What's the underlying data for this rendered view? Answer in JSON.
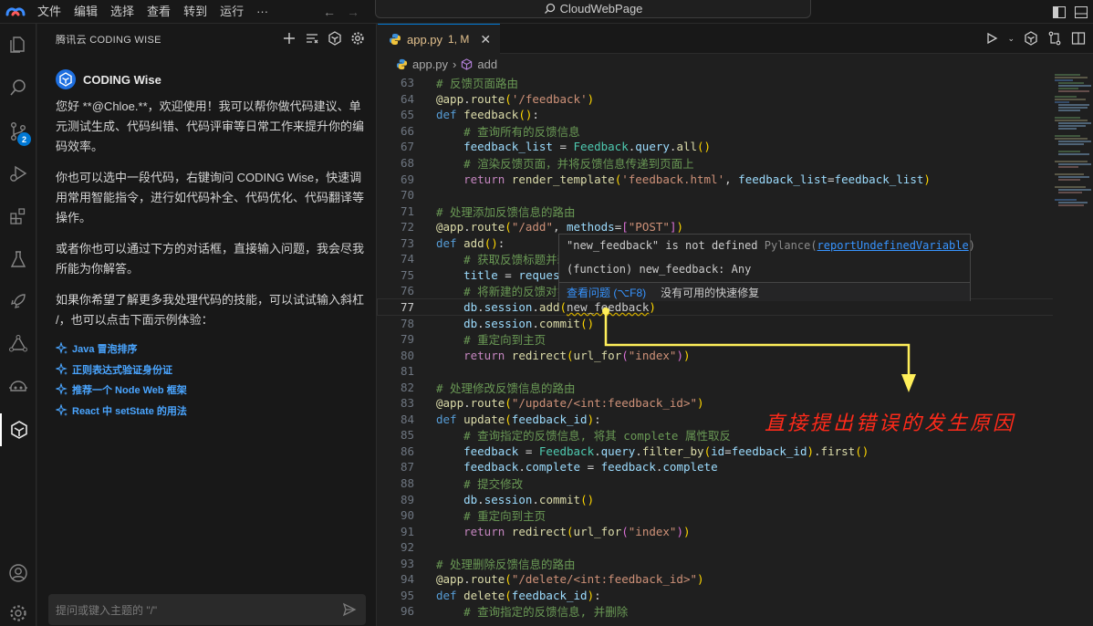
{
  "titlebar": {
    "menu": [
      "文件",
      "编辑",
      "选择",
      "查看",
      "转到",
      "运行",
      "···"
    ],
    "search_text": "CloudWebPage"
  },
  "activity": {
    "source_control_badge": "2"
  },
  "sidepanel": {
    "header": "腾讯云 CODING WISE",
    "bot_name": "CODING Wise",
    "messages": [
      "您好 **@Chloe.**，欢迎使用！我可以帮你做代码建议、单元测试生成、代码纠错、代码评审等日常工作来提升你的编码效率。",
      "你也可以选中一段代码，右键询问 CODING Wise，快速调用常用智能指令，进行如代码补全、代码优化、代码翻译等操作。",
      "或者你也可以通过下方的对话框，直接输入问题，我会尽我所能为你解答。",
      "如果你希望了解更多我处理代码的技能，可以试试输入斜杠 /，也可以点击下面示例体验："
    ],
    "examples": [
      "Java 冒泡排序",
      "正则表达式验证身份证",
      "推荐一个 Node Web 框架",
      "React 中 setState 的用法"
    ],
    "input_placeholder": "提问或键入主题的 \"/\""
  },
  "editor": {
    "tab_name": "app.py",
    "tab_status": "1, M",
    "breadcrumb": [
      "app.py",
      "add"
    ],
    "lines": [
      {
        "n": "63",
        "t": [
          [
            "c-com",
            "# 反馈页面路由"
          ]
        ]
      },
      {
        "n": "64",
        "t": [
          [
            "c-dec",
            "@app"
          ],
          [
            "c-pl",
            "."
          ],
          [
            "c-fn",
            "route"
          ],
          [
            "c-p1",
            "("
          ],
          [
            "c-str",
            "'/feedback'"
          ],
          [
            "c-p1",
            ")"
          ]
        ]
      },
      {
        "n": "65",
        "t": [
          [
            "c-kw",
            "def "
          ],
          [
            "c-fn",
            "feedback"
          ],
          [
            "c-p1",
            "()"
          ],
          [
            "c-pl",
            ":"
          ]
        ]
      },
      {
        "n": "66",
        "t": [
          [
            "c-pl",
            "    "
          ],
          [
            "c-com",
            "# 查询所有的反馈信息"
          ]
        ]
      },
      {
        "n": "67",
        "t": [
          [
            "c-pl",
            "    "
          ],
          [
            "c-var",
            "feedback_list"
          ],
          [
            "c-pl",
            " = "
          ],
          [
            "c-cls",
            "Feedback"
          ],
          [
            "c-pl",
            "."
          ],
          [
            "c-var",
            "query"
          ],
          [
            "c-pl",
            "."
          ],
          [
            "c-fn",
            "all"
          ],
          [
            "c-p1",
            "()"
          ]
        ]
      },
      {
        "n": "68",
        "t": [
          [
            "c-pl",
            "    "
          ],
          [
            "c-com",
            "# 渲染反馈页面，并将反馈信息传递到页面上"
          ]
        ]
      },
      {
        "n": "69",
        "t": [
          [
            "c-pl",
            "    "
          ],
          [
            "c-ctl",
            "return "
          ],
          [
            "c-fn",
            "render_template"
          ],
          [
            "c-p1",
            "("
          ],
          [
            "c-str",
            "'feedback.html'"
          ],
          [
            "c-pl",
            ", "
          ],
          [
            "c-var",
            "feedback_list"
          ],
          [
            "c-pl",
            "="
          ],
          [
            "c-var",
            "feedback_list"
          ],
          [
            "c-p1",
            ")"
          ]
        ]
      },
      {
        "n": "70",
        "t": []
      },
      {
        "n": "71",
        "t": [
          [
            "c-com",
            "# 处理添加反馈信息的路由"
          ]
        ]
      },
      {
        "n": "72",
        "t": [
          [
            "c-dec",
            "@app"
          ],
          [
            "c-pl",
            "."
          ],
          [
            "c-fn",
            "route"
          ],
          [
            "c-p1",
            "("
          ],
          [
            "c-str",
            "\"/add\""
          ],
          [
            "c-pl",
            ", "
          ],
          [
            "c-var",
            "methods"
          ],
          [
            "c-pl",
            "="
          ],
          [
            "c-p2",
            "["
          ],
          [
            "c-str",
            "\"POST\""
          ],
          [
            "c-p2",
            "]"
          ],
          [
            "c-p1",
            ")"
          ]
        ]
      },
      {
        "n": "73",
        "t": [
          [
            "c-kw",
            "def "
          ],
          [
            "c-fn",
            "add"
          ],
          [
            "c-p1",
            "()"
          ],
          [
            "c-pl",
            ":"
          ]
        ]
      },
      {
        "n": "74",
        "t": [
          [
            "c-pl",
            "    "
          ],
          [
            "c-com",
            "# 获取反馈标题并新"
          ]
        ]
      },
      {
        "n": "75",
        "t": [
          [
            "c-pl",
            "    "
          ],
          [
            "c-var",
            "title"
          ],
          [
            "c-pl",
            " = "
          ],
          [
            "c-var",
            "request"
          ]
        ]
      },
      {
        "n": "76",
        "t": [
          [
            "c-pl",
            "    "
          ],
          [
            "c-com",
            "# 将新建的反馈对象"
          ]
        ]
      },
      {
        "n": "77",
        "t": [
          [
            "c-pl",
            "    "
          ],
          [
            "c-var",
            "db"
          ],
          [
            "c-pl",
            "."
          ],
          [
            "c-var",
            "session"
          ],
          [
            "c-pl",
            "."
          ],
          [
            "c-fn",
            "add"
          ],
          [
            "c-p1",
            "("
          ],
          [
            "c-err",
            "new_feedback"
          ],
          [
            "c-p1",
            ")"
          ]
        ],
        "current": true
      },
      {
        "n": "78",
        "t": [
          [
            "c-pl",
            "    "
          ],
          [
            "c-var",
            "db"
          ],
          [
            "c-pl",
            "."
          ],
          [
            "c-var",
            "session"
          ],
          [
            "c-pl",
            "."
          ],
          [
            "c-fn",
            "commit"
          ],
          [
            "c-p1",
            "()"
          ]
        ]
      },
      {
        "n": "79",
        "t": [
          [
            "c-pl",
            "    "
          ],
          [
            "c-com",
            "# 重定向到主页"
          ]
        ]
      },
      {
        "n": "80",
        "t": [
          [
            "c-pl",
            "    "
          ],
          [
            "c-ctl",
            "return "
          ],
          [
            "c-fn",
            "redirect"
          ],
          [
            "c-p1",
            "("
          ],
          [
            "c-fn",
            "url_for"
          ],
          [
            "c-p2",
            "("
          ],
          [
            "c-str",
            "\"index\""
          ],
          [
            "c-p2",
            ")"
          ],
          [
            "c-p1",
            ")"
          ]
        ]
      },
      {
        "n": "81",
        "t": []
      },
      {
        "n": "82",
        "t": [
          [
            "c-com",
            "# 处理修改反馈信息的路由"
          ]
        ]
      },
      {
        "n": "83",
        "t": [
          [
            "c-dec",
            "@app"
          ],
          [
            "c-pl",
            "."
          ],
          [
            "c-fn",
            "route"
          ],
          [
            "c-p1",
            "("
          ],
          [
            "c-str",
            "\"/update/<int:feedback_id>\""
          ],
          [
            "c-p1",
            ")"
          ]
        ]
      },
      {
        "n": "84",
        "t": [
          [
            "c-kw",
            "def "
          ],
          [
            "c-fn",
            "update"
          ],
          [
            "c-p1",
            "("
          ],
          [
            "c-var",
            "feedback_id"
          ],
          [
            "c-p1",
            ")"
          ],
          [
            "c-pl",
            ":"
          ]
        ]
      },
      {
        "n": "85",
        "t": [
          [
            "c-pl",
            "    "
          ],
          [
            "c-com",
            "# 查询指定的反馈信息, 将其 complete 属性取反"
          ]
        ]
      },
      {
        "n": "86",
        "t": [
          [
            "c-pl",
            "    "
          ],
          [
            "c-var",
            "feedback"
          ],
          [
            "c-pl",
            " = "
          ],
          [
            "c-cls",
            "Feedback"
          ],
          [
            "c-pl",
            "."
          ],
          [
            "c-var",
            "query"
          ],
          [
            "c-pl",
            "."
          ],
          [
            "c-fn",
            "filter_by"
          ],
          [
            "c-p1",
            "("
          ],
          [
            "c-var",
            "id"
          ],
          [
            "c-pl",
            "="
          ],
          [
            "c-var",
            "feedback_id"
          ],
          [
            "c-p1",
            ")"
          ],
          [
            "c-pl",
            "."
          ],
          [
            "c-fn",
            "first"
          ],
          [
            "c-p1",
            "()"
          ]
        ]
      },
      {
        "n": "87",
        "t": [
          [
            "c-pl",
            "    "
          ],
          [
            "c-var",
            "feedback"
          ],
          [
            "c-pl",
            "."
          ],
          [
            "c-var",
            "complete"
          ],
          [
            "c-pl",
            " = "
          ],
          [
            "c-var",
            "feedback"
          ],
          [
            "c-pl",
            "."
          ],
          [
            "c-var",
            "complete"
          ]
        ]
      },
      {
        "n": "88",
        "t": [
          [
            "c-pl",
            "    "
          ],
          [
            "c-com",
            "# 提交修改"
          ]
        ]
      },
      {
        "n": "89",
        "t": [
          [
            "c-pl",
            "    "
          ],
          [
            "c-var",
            "db"
          ],
          [
            "c-pl",
            "."
          ],
          [
            "c-var",
            "session"
          ],
          [
            "c-pl",
            "."
          ],
          [
            "c-fn",
            "commit"
          ],
          [
            "c-p1",
            "()"
          ]
        ]
      },
      {
        "n": "90",
        "t": [
          [
            "c-pl",
            "    "
          ],
          [
            "c-com",
            "# 重定向到主页"
          ]
        ]
      },
      {
        "n": "91",
        "t": [
          [
            "c-pl",
            "    "
          ],
          [
            "c-ctl",
            "return "
          ],
          [
            "c-fn",
            "redirect"
          ],
          [
            "c-p1",
            "("
          ],
          [
            "c-fn",
            "url_for"
          ],
          [
            "c-p2",
            "("
          ],
          [
            "c-str",
            "\"index\""
          ],
          [
            "c-p2",
            ")"
          ],
          [
            "c-p1",
            ")"
          ]
        ]
      },
      {
        "n": "92",
        "t": []
      },
      {
        "n": "93",
        "t": [
          [
            "c-com",
            "# 处理删除反馈信息的路由"
          ]
        ]
      },
      {
        "n": "94",
        "t": [
          [
            "c-dec",
            "@app"
          ],
          [
            "c-pl",
            "."
          ],
          [
            "c-fn",
            "route"
          ],
          [
            "c-p1",
            "("
          ],
          [
            "c-str",
            "\"/delete/<int:feedback_id>\""
          ],
          [
            "c-p1",
            ")"
          ]
        ]
      },
      {
        "n": "95",
        "t": [
          [
            "c-kw",
            "def "
          ],
          [
            "c-fn",
            "delete"
          ],
          [
            "c-p1",
            "("
          ],
          [
            "c-var",
            "feedback_id"
          ],
          [
            "c-p1",
            ")"
          ],
          [
            "c-pl",
            ":"
          ]
        ]
      },
      {
        "n": "96",
        "t": [
          [
            "c-pl",
            "    "
          ],
          [
            "c-com",
            "# 查询指定的反馈信息, 并删除"
          ]
        ]
      }
    ]
  },
  "hover": {
    "message": "\"new_feedback\" is not defined",
    "source": "Pylance(",
    "rule": "reportUndefinedVariable",
    "source_end": ")",
    "signature": "(function) new_feedback: Any",
    "view_problem": "查看问题 (⌥F8)",
    "no_fix": "没有可用的快速修复"
  },
  "annotation": "直接提出错误的发生原因"
}
